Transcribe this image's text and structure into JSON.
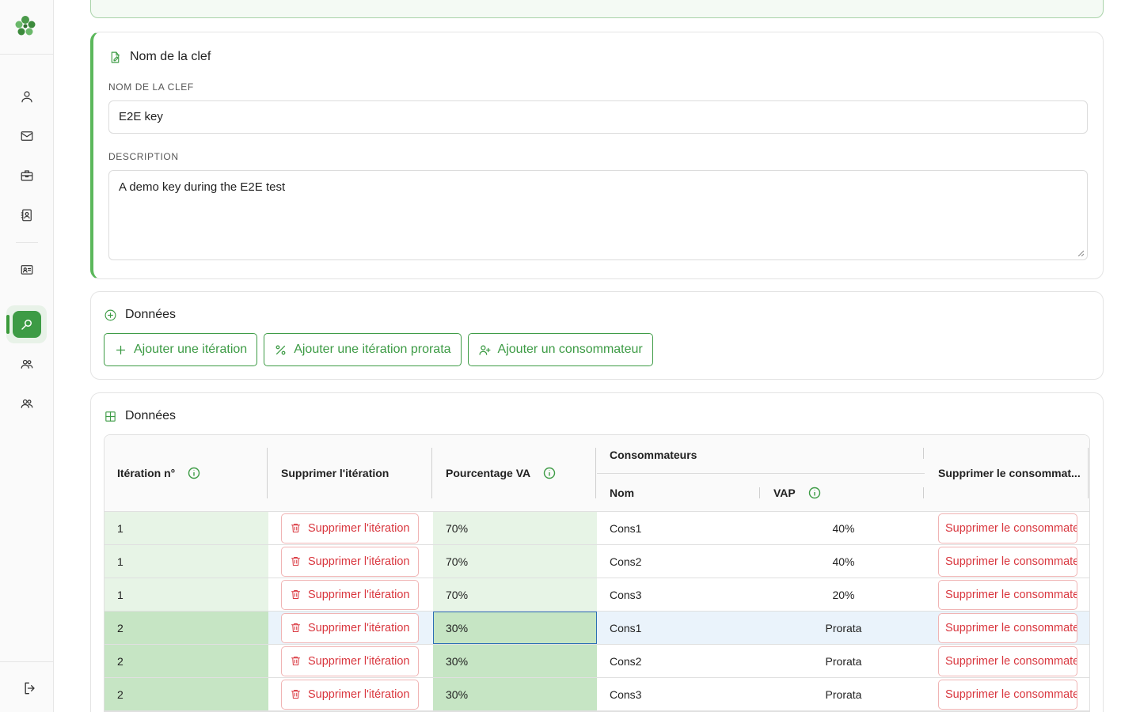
{
  "sidebar": {
    "items": [
      {
        "icon": "user-icon"
      },
      {
        "icon": "mail-icon"
      },
      {
        "icon": "briefcase-icon"
      },
      {
        "icon": "contact-book-icon"
      },
      {
        "icon": "id-card-icon"
      },
      {
        "icon": "key-search-icon",
        "active": true
      },
      {
        "icon": "users-icon"
      },
      {
        "icon": "users-group-icon"
      }
    ],
    "logout_icon": "logout-icon"
  },
  "key_card": {
    "title": "Nom de la clef",
    "name_label": "NOM DE LA CLEF",
    "name_value": "E2E key",
    "desc_label": "DESCRIPTION",
    "desc_value": "A demo key during the E2E test"
  },
  "actions_card": {
    "title": "Données",
    "buttons": {
      "add_iteration": "Ajouter une itération",
      "add_prorata": "Ajouter une itération prorata",
      "add_consumer": "Ajouter un consommateur"
    }
  },
  "table_card": {
    "title": "Données",
    "headers": {
      "iteration": "Itération n°",
      "delete_iteration": "Supprimer l'itération",
      "percentage": "Pourcentage VA",
      "consumers": "Consommateurs",
      "name": "Nom",
      "vap": "VAP",
      "delete_consumer": "Supprimer le consommat..."
    },
    "rows": [
      {
        "iteration": "1",
        "delete_label": "Supprimer l'itération",
        "percentage": "70%",
        "name": "Cons1",
        "vap": "40%",
        "delete_consumer_label": "Supprimer le consommateur"
      },
      {
        "iteration": "1",
        "delete_label": "Supprimer l'itération",
        "percentage": "70%",
        "name": "Cons2",
        "vap": "40%",
        "delete_consumer_label": "Supprimer le consommateur"
      },
      {
        "iteration": "1",
        "delete_label": "Supprimer l'itération",
        "percentage": "70%",
        "name": "Cons3",
        "vap": "20%",
        "delete_consumer_label": "Supprimer le consommateur"
      },
      {
        "iteration": "2",
        "delete_label": "Supprimer l'itération",
        "percentage": "30%",
        "name": "Cons1",
        "vap": "Prorata",
        "delete_consumer_label": "Supprimer le consommateur"
      },
      {
        "iteration": "2",
        "delete_label": "Supprimer l'itération",
        "percentage": "30%",
        "name": "Cons2",
        "vap": "Prorata",
        "delete_consumer_label": "Supprimer le consommateur"
      },
      {
        "iteration": "2",
        "delete_label": "Supprimer l'itération",
        "percentage": "30%",
        "name": "Cons3",
        "vap": "Prorata",
        "delete_consumer_label": "Supprimer le consommateur"
      }
    ]
  },
  "colors": {
    "accent": "#3d9b45",
    "danger": "#d9363e",
    "iteration1_bg": "#e7f4e6",
    "iteration2_bg": "#c6e5c4",
    "selected_row_bg": "#eaf3fb"
  }
}
